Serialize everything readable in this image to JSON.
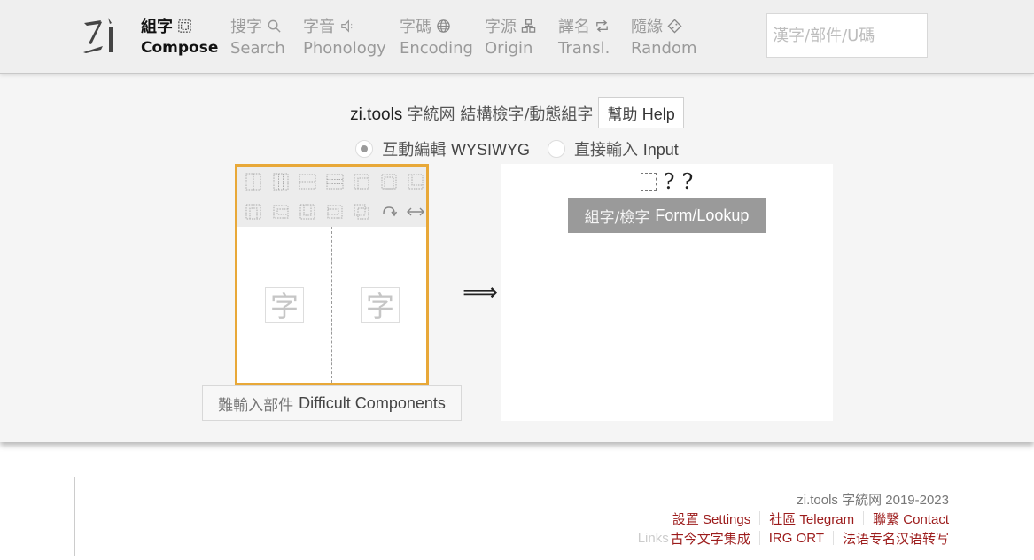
{
  "header": {
    "logo_alt": "zi",
    "nav": [
      {
        "zh": "組字",
        "en": "Compose",
        "icon": "compose-box-icon",
        "active": true
      },
      {
        "zh": "搜字",
        "en": "Search",
        "icon": "search-icon",
        "active": false
      },
      {
        "zh": "字音",
        "en": "Phonology",
        "icon": "speaker-icon",
        "active": false
      },
      {
        "zh": "字碼",
        "en": "Encoding",
        "icon": "globe-icon",
        "active": false
      },
      {
        "zh": "字源",
        "en": "Origin",
        "icon": "hierarchy-icon",
        "active": false
      },
      {
        "zh": "譯名",
        "en": "Transl.",
        "icon": "swap-icon",
        "active": false
      },
      {
        "zh": "隨緣",
        "en": "Random",
        "icon": "dice-icon",
        "active": false
      }
    ],
    "search": {
      "placeholder": "漢字/部件/U碼",
      "value": ""
    }
  },
  "main": {
    "title_en": "zi.tools",
    "title_zh": "字統网 結構檢字/動態組字",
    "help": {
      "zh": "幫助",
      "en": "Help"
    },
    "modes": [
      {
        "zh": "互動編輯",
        "en": "WYSIWYG",
        "selected": true
      },
      {
        "zh": "直接輸入",
        "en": "Input",
        "selected": false
      }
    ],
    "editor": {
      "toolbar": [
        "left-right-layout-icon",
        "left-middle-right-layout-icon",
        "top-bottom-layout-icon",
        "top-middle-bottom-layout-icon",
        "surround-top-layout-icon",
        "surround-full-layout-icon",
        "surround-bottom-left-layout-icon",
        "surround-top-open-layout-icon",
        "surround-left-layout-icon",
        "surround-bottom-open-layout-icon",
        "surround-right-layout-icon",
        "overlap-layout-icon",
        "rotate-icon",
        "flip-horizontal-icon"
      ],
      "slots": [
        "字",
        "字"
      ]
    },
    "difficult": {
      "zh": "難輸入部件",
      "en": "Difficult Components"
    },
    "arrow": "⟹",
    "result": {
      "sequence": [
        "?",
        "?"
      ],
      "form_button": {
        "zh": "組字/檢字",
        "en": "Form/Lookup"
      }
    }
  },
  "footer": {
    "copyright": "zi.tools 字統网 2019-2023",
    "links_row1": [
      "設置 Settings",
      "社區 Telegram",
      "聯繫 Contact"
    ],
    "links_label": "Links",
    "links_row2": [
      "古今文字集成",
      "IRG ORT",
      "法语专名汉语转写"
    ]
  },
  "colors": {
    "accent_border": "#e8a838",
    "link": "#9c1b1b",
    "form_button_bg": "#9a9a9a"
  }
}
